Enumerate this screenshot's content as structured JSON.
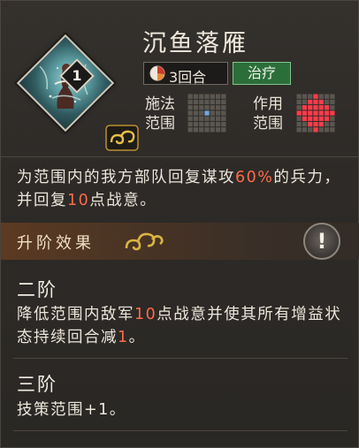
{
  "skill": {
    "level": "1",
    "name": "沉鱼落雁",
    "cooldown": "3回合",
    "type": "治疗",
    "cast_range_label": [
      "施法",
      "范围"
    ],
    "effect_range_label": [
      "作用",
      "范围"
    ]
  },
  "description": {
    "p1": "为范围内的我方部队回复谋攻",
    "v1": "60%",
    "p2": "的兵力，并回复",
    "v2": "10",
    "p3": "点战意。"
  },
  "upgrade": {
    "title": "升阶效果",
    "alert": "!",
    "ranks": [
      {
        "title": "二阶",
        "p1": "降低范围内敌军",
        "v1": "10",
        "p2": "点战意并使其所有增益状态持续回合减",
        "v2": "1",
        "p3": "。"
      },
      {
        "title": "三阶",
        "text": "技策范围+1。"
      }
    ]
  },
  "colors": {
    "highlight": "#ff6a4a",
    "heal_tag": "#2c6e3a",
    "cast_cell": "#6fa7e0",
    "effect_cell": "#ff3b4a"
  },
  "icons": {
    "skill_art": "fish-beauty-art",
    "cloud": "gold-cloud-emblem",
    "cooldown": "pie-timer-icon",
    "alert": "exclamation-icon"
  }
}
